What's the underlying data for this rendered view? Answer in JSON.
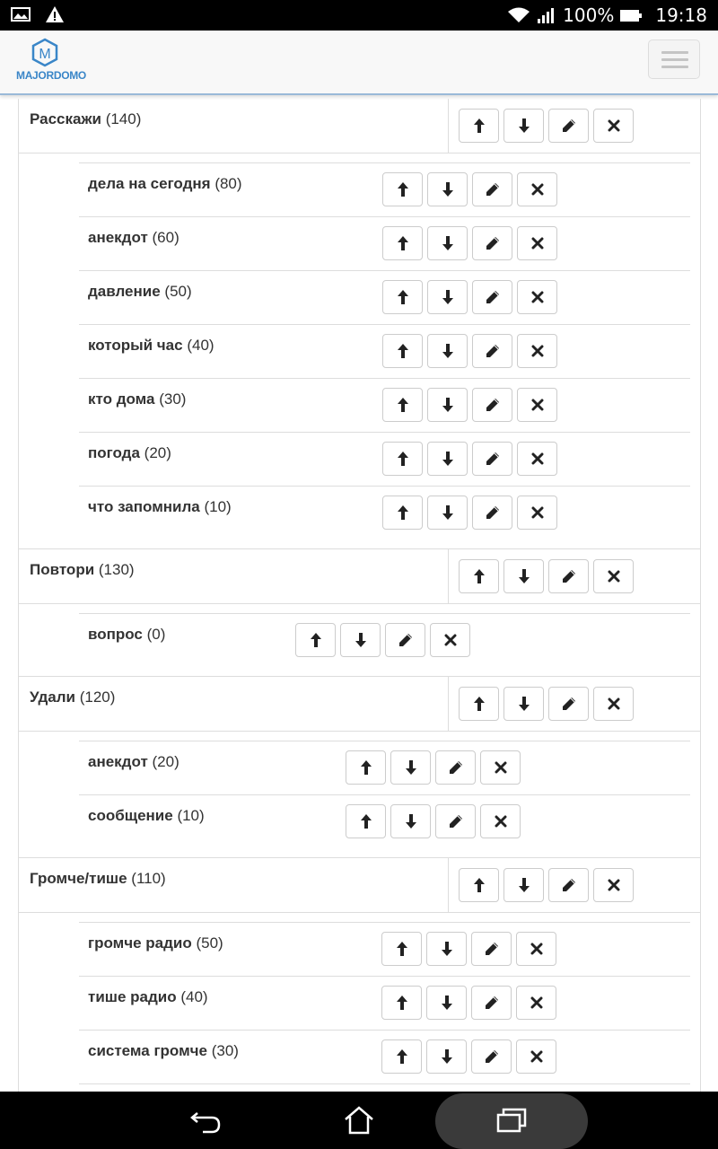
{
  "status_bar": {
    "battery": "100%",
    "time": "19:18"
  },
  "app": {
    "logo_letter": "M",
    "logo_text": "MAJORDOMO"
  },
  "groups": [
    {
      "title": "Расскажи",
      "count": "(140)",
      "items": [
        {
          "title": "дела на сегодня",
          "count": "(80)"
        },
        {
          "title": "анекдот",
          "count": "(60)"
        },
        {
          "title": "давление",
          "count": "(50)"
        },
        {
          "title": "который час",
          "count": "(40)"
        },
        {
          "title": "кто дома",
          "count": "(30)"
        },
        {
          "title": "погода",
          "count": "(20)"
        },
        {
          "title": "что запомнила",
          "count": "(10)"
        }
      ]
    },
    {
      "title": "Повтори",
      "count": "(130)",
      "items": [
        {
          "title": "вопрос",
          "count": "(0)"
        }
      ]
    },
    {
      "title": "Удали",
      "count": "(120)",
      "items": [
        {
          "title": "анекдот",
          "count": "(20)"
        },
        {
          "title": "сообщение",
          "count": "(10)"
        }
      ]
    },
    {
      "title": "Громче/тише",
      "count": "(110)",
      "items": [
        {
          "title": "громче радио",
          "count": "(50)"
        },
        {
          "title": "тише радио",
          "count": "(40)"
        },
        {
          "title": "система громче",
          "count": "(30)"
        }
      ]
    }
  ],
  "row_actions": [
    "move-up",
    "move-down",
    "edit",
    "delete"
  ],
  "colors": {
    "accent": "#3a86c8",
    "border": "#dddddd",
    "status_bar": "#000000"
  }
}
